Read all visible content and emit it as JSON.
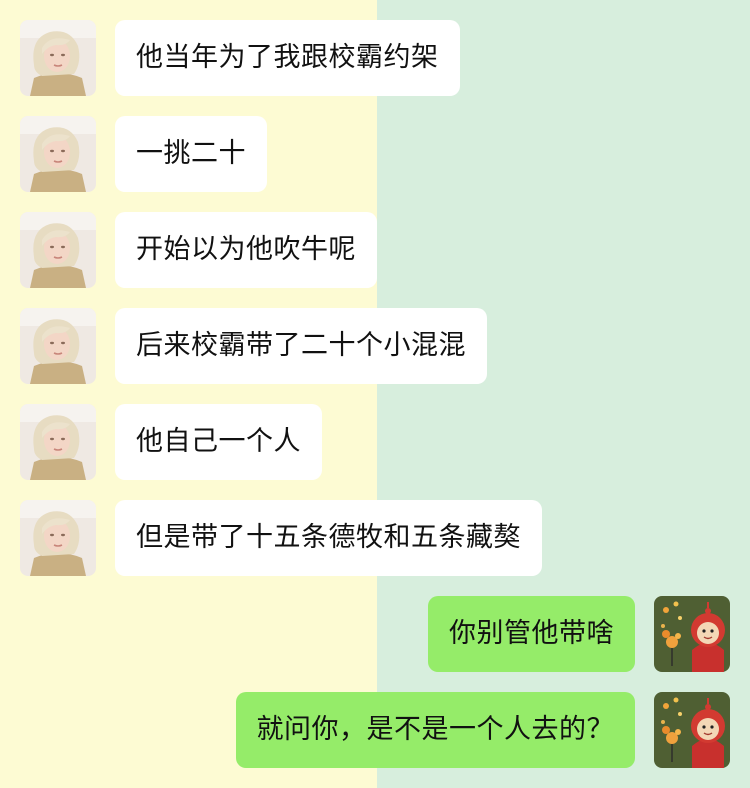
{
  "theme": {
    "left_bg": "#fdfbd3",
    "right_bg": "#d7eedd",
    "incoming_bubble": "#ffffff",
    "outgoing_bubble": "#95ec69",
    "text_color": "#111111"
  },
  "messages": [
    {
      "side": "left",
      "text": "他当年为了我跟校霸约架"
    },
    {
      "side": "left",
      "text": "一挑二十"
    },
    {
      "side": "left",
      "text": "开始以为他吹牛呢"
    },
    {
      "side": "left",
      "text": "后来校霸带了二十个小混混"
    },
    {
      "side": "left",
      "text": "他自己一个人"
    },
    {
      "side": "left",
      "text": "但是带了十五条德牧和五条藏獒"
    },
    {
      "side": "right",
      "text": "你别管他带啥"
    },
    {
      "side": "right",
      "text": "就问你，是不是一个人去的？"
    }
  ],
  "avatars": {
    "left": "blonde-woman-avatar",
    "right": "teletubby-cartoon-avatar"
  }
}
